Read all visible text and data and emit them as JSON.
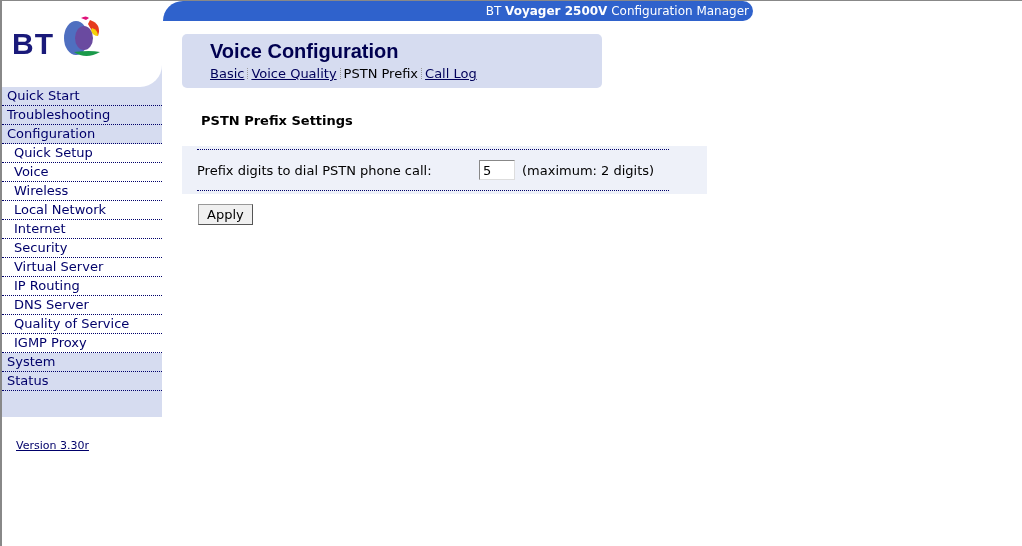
{
  "logo": {
    "text": "BT"
  },
  "header": {
    "title": "BT **Voyager 2500V** Configuration Manager"
  },
  "sidebar": {
    "items": [
      {
        "label": "Quick Start"
      },
      {
        "label": "Troubleshooting"
      },
      {
        "label": "Configuration",
        "children": [
          {
            "label": "Quick Setup"
          },
          {
            "label": "Voice"
          },
          {
            "label": "Wireless"
          },
          {
            "label": "Local Network"
          },
          {
            "label": "Internet"
          },
          {
            "label": "Security"
          },
          {
            "label": "Virtual Server"
          },
          {
            "label": "IP Routing"
          },
          {
            "label": "DNS Server"
          },
          {
            "label": "Quality of Service"
          },
          {
            "label": "IGMP Proxy"
          }
        ]
      },
      {
        "label": "System"
      },
      {
        "label": "Status"
      }
    ],
    "version": "Version 3.30r"
  },
  "page": {
    "title": "Voice Configuration",
    "tabs": [
      {
        "label": "Basic",
        "selected": false
      },
      {
        "label": "Voice Quality",
        "selected": false
      },
      {
        "label": "PSTN Prefix",
        "selected": true
      },
      {
        "label": "Call Log",
        "selected": false
      }
    ],
    "section_title": "PSTN Prefix Settings",
    "field": {
      "label": "Prefix digits to dial PSTN phone call:",
      "value": "5",
      "hint": "(maximum: 2 digits)"
    },
    "button": "Apply"
  }
}
